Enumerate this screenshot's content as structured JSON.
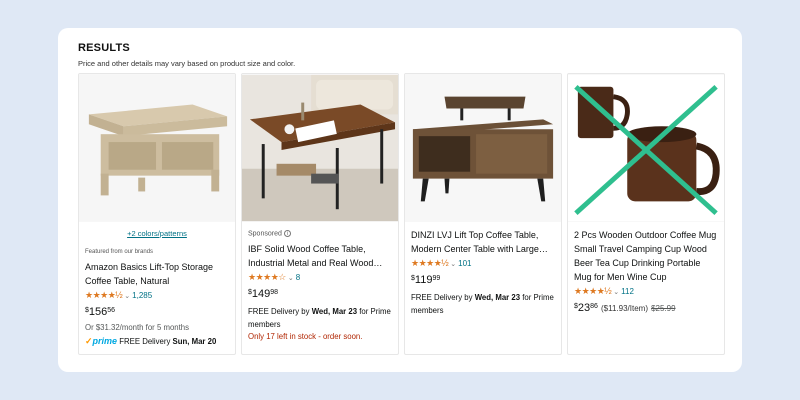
{
  "header": {
    "title": "RESULTS",
    "subtitle": "Price and other details may vary based on product size and color."
  },
  "products": [
    {
      "colors_link": "+2 colors/patterns",
      "featured": "Featured from our brands",
      "title": "Amazon Basics Lift-Top Storage Coffee Table, Natural",
      "stars": "★★★★½",
      "rating_count": "1,285",
      "price_symbol": "$",
      "price_whole": "156",
      "price_fraction": "56",
      "monthly": "Or $31.32/month for 5 months",
      "prime_label": "prime",
      "delivery_prefix": "FREE Delivery",
      "delivery_date": "Sun, Mar 20"
    },
    {
      "sponsored": "Sponsored",
      "title": "IBF Solid Wood Coffee Table, Industrial Metal and Real Wood…",
      "stars": "★★★★☆",
      "rating_count": "8",
      "price_symbol": "$",
      "price_whole": "149",
      "price_fraction": "98",
      "delivery_prefix": "FREE Delivery by",
      "delivery_date": "Wed, Mar 23",
      "delivery_suffix": "for Prime members",
      "stock": "Only 17 left in stock - order soon."
    },
    {
      "title": "DINZI LVJ Lift Top Coffee Table, Modern Center Table with Large…",
      "stars": "★★★★½",
      "rating_count": "101",
      "price_symbol": "$",
      "price_whole": "119",
      "price_fraction": "99",
      "delivery_prefix": "FREE Delivery by",
      "delivery_date": "Wed, Mar 23",
      "delivery_suffix": "for Prime members"
    },
    {
      "title": "2 Pcs Wooden Outdoor Coffee Mug Small Travel Camping Cup Wood Beer Tea Cup Drinking Portable Mug for Men Wine Cup",
      "stars": "★★★★½",
      "rating_count": "112",
      "price_symbol": "$",
      "price_whole": "23",
      "price_fraction": "86",
      "unit_price": "($11.93/Item)",
      "list_price": "$25.99"
    }
  ],
  "colors": {
    "background": "#dfe8f5",
    "star": "#de7921",
    "link": "#007185",
    "stock_red": "#b12704",
    "cross_green": "#2fbf8f"
  }
}
